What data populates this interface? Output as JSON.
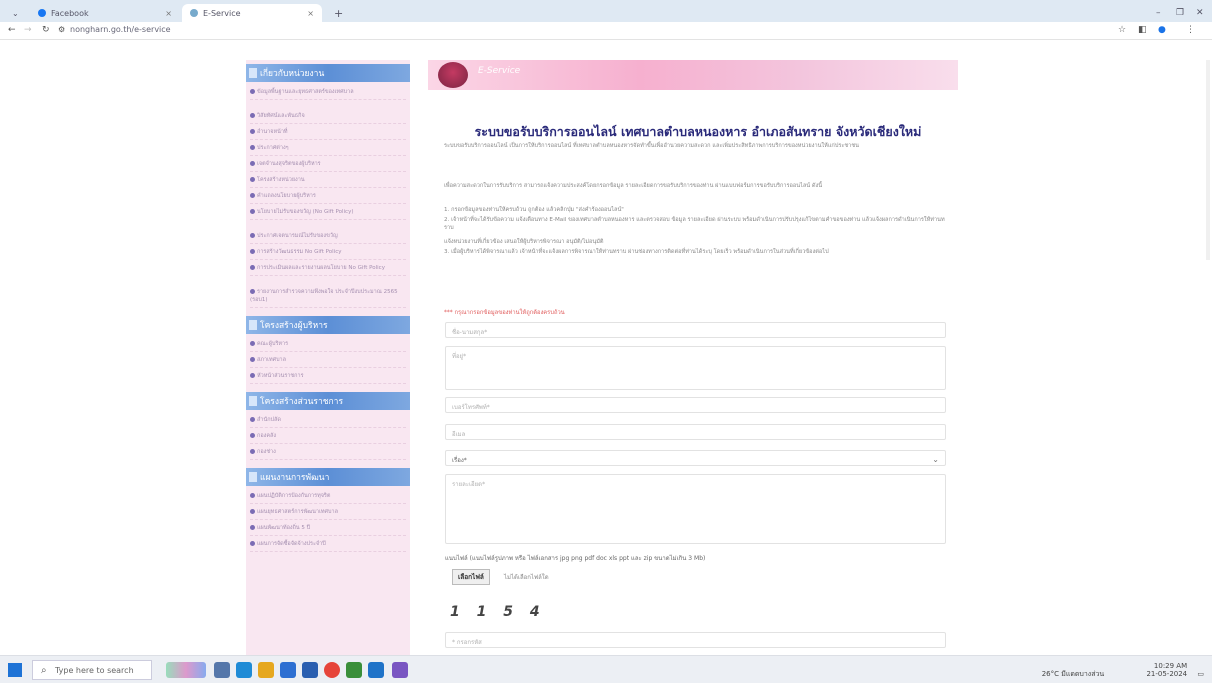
{
  "browser": {
    "tabs": [
      {
        "label": "Facebook",
        "active": false
      },
      {
        "label": "E-Service",
        "active": true
      }
    ],
    "new_tab": "+",
    "url": "nongharn.go.th/e-service",
    "window_controls": [
      "–",
      "❐",
      "✕"
    ]
  },
  "sidebar": {
    "sections": [
      {
        "title": "เกี่ยวกับหน่วยงาน",
        "items": [
          "ข้อมูลพื้นฐานและยุทธศาสตร์ของเทศบาล",
          "วิสัยทัศน์และพันธกิจ",
          "อำนาจหน้าที่",
          "ประกาศต่างๆ",
          "เจตจำนงสุจริตของผู้บริหาร",
          "โครงสร้างหน่วยงาน",
          "คำแถลงนโยบายผู้บริหาร",
          "นโยบายไม่รับของขวัญ (No Gift Policy)",
          "ประกาศเจตนารมณ์ไม่รับของขวัญ",
          "การสร้างวัฒนธรรม No Gift Policy",
          "การประเมินผลและรายงานผลนโยบาย No Gift Policy",
          "รายงานการสำรวจความพึงพอใจ ประจำปีงบประมาณ 2565 (รอบ1)"
        ]
      },
      {
        "title": "โครงสร้างผู้บริหาร",
        "items": [
          "คณะผู้บริหาร",
          "สภาเทศบาล",
          "หัวหน้าส่วนราชการ"
        ]
      },
      {
        "title": "โครงสร้างส่วนราชการ",
        "items": [
          "สำนักปลัด",
          "กองคลัง",
          "กองช่าง"
        ]
      },
      {
        "title": "แผนงานการพัฒนา",
        "items": [
          "แผนปฏิบัติการป้องกันการทุจริต",
          "แผนยุทธศาสตร์การพัฒนาเทศบาล",
          "แผนพัฒนาท้องถิ่น 5 ปี",
          "แผนการจัดซื้อจัดจ้างประจำปี"
        ]
      }
    ]
  },
  "banner": {
    "text": "E-Service"
  },
  "main": {
    "title": "ระบบขอรับบริการออนไลน์ เทศบาลตำบลหนองหาร อำเภอสันทราย จังหวัดเชียงใหม่",
    "intro": "ระบบขอรับบริการออนไลน์ เป็นการให้บริการออนไลน์ ที่เทศบาลตำบลหนองหารจัดทำขึ้นเพื่ออำนวยความสะดวก และเพิ่มประสิทธิภาพการบริการของหน่วยงานให้แก่ประชาชน",
    "steps": [
      "เพื่อความสะดวกในการรับบริการ สามารถแจ้งความประสงค์โดยกรอกข้อมูล รายละเอียดการขอรับบริการของท่าน ผ่านแบบฟอร์มการขอรับบริการออนไลน์ ดังนี้",
      "1. กรอกข้อมูลของท่านให้ครบถ้วน ถูกต้อง แล้วคลิกปุ่ม \"ส่งคำร้องออนไลน์\"",
      "2. เจ้าหน้าที่จะได้รับข้อความ แจ้งเตือนทาง E-Mail ของเทศบาลตำบลหนองหาร และตรวจสอบ ข้อมูล รายละเอียด ผ่านระบบ พร้อมดำเนินการปรับปรุงแก้ไขตามคำขอของท่าน แล้วแจ้งผลการดำเนินการให้ท่านทราบ",
      "แจ้งหน่วยงานที่เกี่ยวข้อง เสนอให้ผู้บริหารพิจารณา อนุมัติ/ไม่อนุมัติ",
      "3. เมื่อผู้บริหารได้พิจารณาแล้ว เจ้าหน้าที่จะแจ้งผลการพิจารณาให้ท่านทราบ ผ่านช่องทางการติดต่อที่ท่านได้ระบุ โดยเร็ว พร้อมดำเนินการในส่วนที่เกี่ยวข้องต่อไป"
    ],
    "warning": "*** กรุณากรอกข้อมูลของท่านให้ถูกต้องครบถ้วน",
    "form": {
      "name_placeholder": "ชื่อ-นามสกุล*",
      "address_placeholder": "ที่อยู่*",
      "phone_placeholder": "เบอร์โทรศัพท์*",
      "email_placeholder": "อีเมล",
      "subject_selected": "เรื่อง*",
      "detail_placeholder": "รายละเอียด*",
      "file_label": "แนบไฟล์ (แนบไฟล์รูปภาพ หรือ ไฟล์เอกสาร jpg png pdf doc xls ppt และ zip ขนาดไม่เกิน 3 Mb)",
      "file_button": "เลือกไฟล์",
      "file_none": "ไม่ได้เลือกไฟล์ใด",
      "captcha": "1 1 5 4",
      "captcha_placeholder": "* กรอกรหัส"
    }
  },
  "taskbar": {
    "search_placeholder": "Type here to search",
    "weather": "26°C มีแดดบางส่วน",
    "time": "10:29 AM",
    "date": "21-05-2024"
  }
}
